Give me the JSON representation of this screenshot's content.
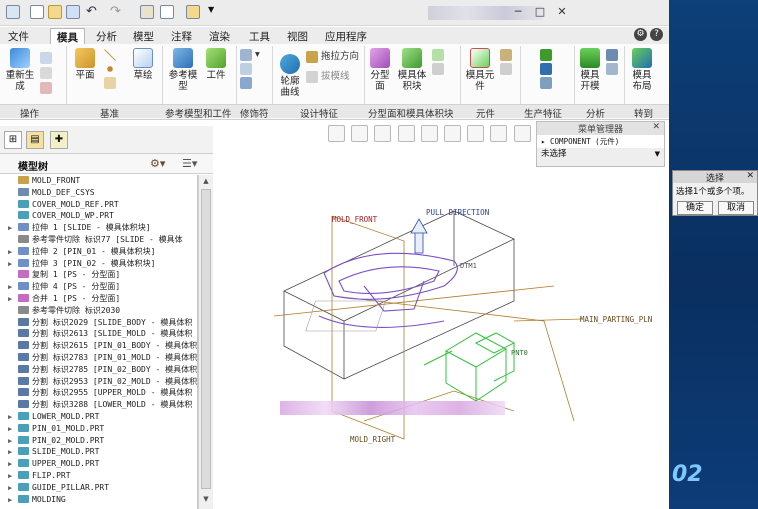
{
  "menu": {
    "file": "文件",
    "tabs": [
      "模具",
      "分析",
      "模型",
      "注释",
      "渲染",
      "工具",
      "视图",
      "应用程序"
    ],
    "active_tab": "模具"
  },
  "ribbon": {
    "buttons": {
      "regen": "重新生\n成",
      "plane": "平面",
      "sketch": "草绘",
      "ref_model": "参考模\n型",
      "workpiece": "工件",
      "draft_dir": "拖拉方向",
      "draft_line": "拔模线",
      "profile_curve": "轮廓\n曲线",
      "parting_surface": "分型\n面",
      "mold_volume": "模具体\n积块",
      "mold_component": "模具元\n件",
      "mold_open": "模具\n开模",
      "mold_layout": "模具\n布局"
    },
    "groups": [
      "操作",
      "基准",
      "参考模型和工件",
      "修饰符",
      "设计特征",
      "分型面和模具体积块",
      "元件",
      "生产特征",
      "分析",
      "转到"
    ]
  },
  "tree": {
    "title": "模型树",
    "rows": [
      {
        "label": "MOLD_FRONT",
        "expander": false,
        "color": "#c8a24a"
      },
      {
        "label": "MOLD_DEF_CSYS",
        "expander": false,
        "color": "#6b8bb0"
      },
      {
        "label": "COVER_MOLD_REF.PRT",
        "expander": false,
        "color": "#4aa0b8"
      },
      {
        "label": "COVER_MOLD_WP.PRT",
        "expander": false,
        "color": "#4aa0b8"
      },
      {
        "label": "拉伸 1 [SLIDE - 模具体积块]",
        "expander": true,
        "color": "#6f8fc8"
      },
      {
        "label": "参考零件切除 标识77 [SLIDE - 模具体",
        "expander": false,
        "color": "#8a8a8a"
      },
      {
        "label": "拉伸 2 [PIN_01 - 模具体积块]",
        "expander": true,
        "color": "#6f8fc8"
      },
      {
        "label": "拉伸 3 [PIN_02 - 模具体积块]",
        "expander": true,
        "color": "#6f8fc8"
      },
      {
        "label": "复制 1 [PS - 分型面]",
        "expander": false,
        "color": "#c56bc4"
      },
      {
        "label": "拉伸 4 [PS - 分型面]",
        "expander": true,
        "color": "#6f8fc8"
      },
      {
        "label": "合并 1 [PS - 分型面]",
        "expander": true,
        "color": "#c56bc4"
      },
      {
        "label": "参考零件切除 标识2030",
        "expander": false,
        "color": "#8a8a8a"
      },
      {
        "label": "分割 标识2029 [SLIDE_BODY - 模具体积",
        "expander": false,
        "color": "#5a7aa5"
      },
      {
        "label": "分割 标识2613 [SLIDE_MOLD - 模具体积",
        "expander": false,
        "color": "#5a7aa5"
      },
      {
        "label": "分割 标识2615 [PIN_01_BODY - 模具体积",
        "expander": false,
        "color": "#5a7aa5"
      },
      {
        "label": "分割 标识2783 [PIN_01_MOLD - 模具体积",
        "expander": false,
        "color": "#5a7aa5"
      },
      {
        "label": "分割 标识2785 [PIN_02_BODY - 模具体积",
        "expander": false,
        "color": "#5a7aa5"
      },
      {
        "label": "分割 标识2953 [PIN_02_MOLD - 模具体积",
        "expander": false,
        "color": "#5a7aa5"
      },
      {
        "label": "分割 标识2955 [UPPER_MOLD - 模具体积",
        "expander": false,
        "color": "#5a7aa5"
      },
      {
        "label": "分割 标识3288 [LOWER_MOLD - 模具体积",
        "expander": false,
        "color": "#5a7aa5"
      },
      {
        "label": "LOWER_MOLD.PRT",
        "expander": true,
        "color": "#4aa0b8"
      },
      {
        "label": "PIN_01_MOLD.PRT",
        "expander": true,
        "color": "#4aa0b8"
      },
      {
        "label": "PIN_02_MOLD.PRT",
        "expander": true,
        "color": "#4aa0b8"
      },
      {
        "label": "SLIDE_MOLD.PRT",
        "expander": true,
        "color": "#4aa0b8"
      },
      {
        "label": "UPPER_MOLD.PRT",
        "expander": true,
        "color": "#4aa0b8"
      },
      {
        "label": "FLIP.PRT",
        "expander": true,
        "color": "#4aa0b8"
      },
      {
        "label": "GUIDE_PILLAR.PRT",
        "expander": true,
        "color": "#4aa0b8"
      },
      {
        "label": "MOLDING",
        "expander": true,
        "color": "#4aa0b8"
      }
    ]
  },
  "graphics": {
    "labels": {
      "mold_front": "MOLD_FRONT",
      "pull_direction": "PULL DIRECTION",
      "main_parting": "MAIN_PARTING_PLN",
      "mold_right": "MOLD_RIGHT",
      "dtm1": "DTM1",
      "pnt0": "PNT0"
    }
  },
  "menu_manager": {
    "title": "菜单管理器",
    "component": "COMPONENT (元件)",
    "selection": "未选择"
  },
  "select_dialog": {
    "title": "选择",
    "text": "选择1个或多个项。",
    "ok": "确定",
    "cancel": "取消"
  },
  "desktop_number": "02",
  "colors": {
    "accent_green": "#2fc43a",
    "mold_front_label": "#a02020",
    "wire_brown": "#b07d2a",
    "purple_part": "#7b4fc8",
    "desktop_blue": "#0a2f60"
  }
}
